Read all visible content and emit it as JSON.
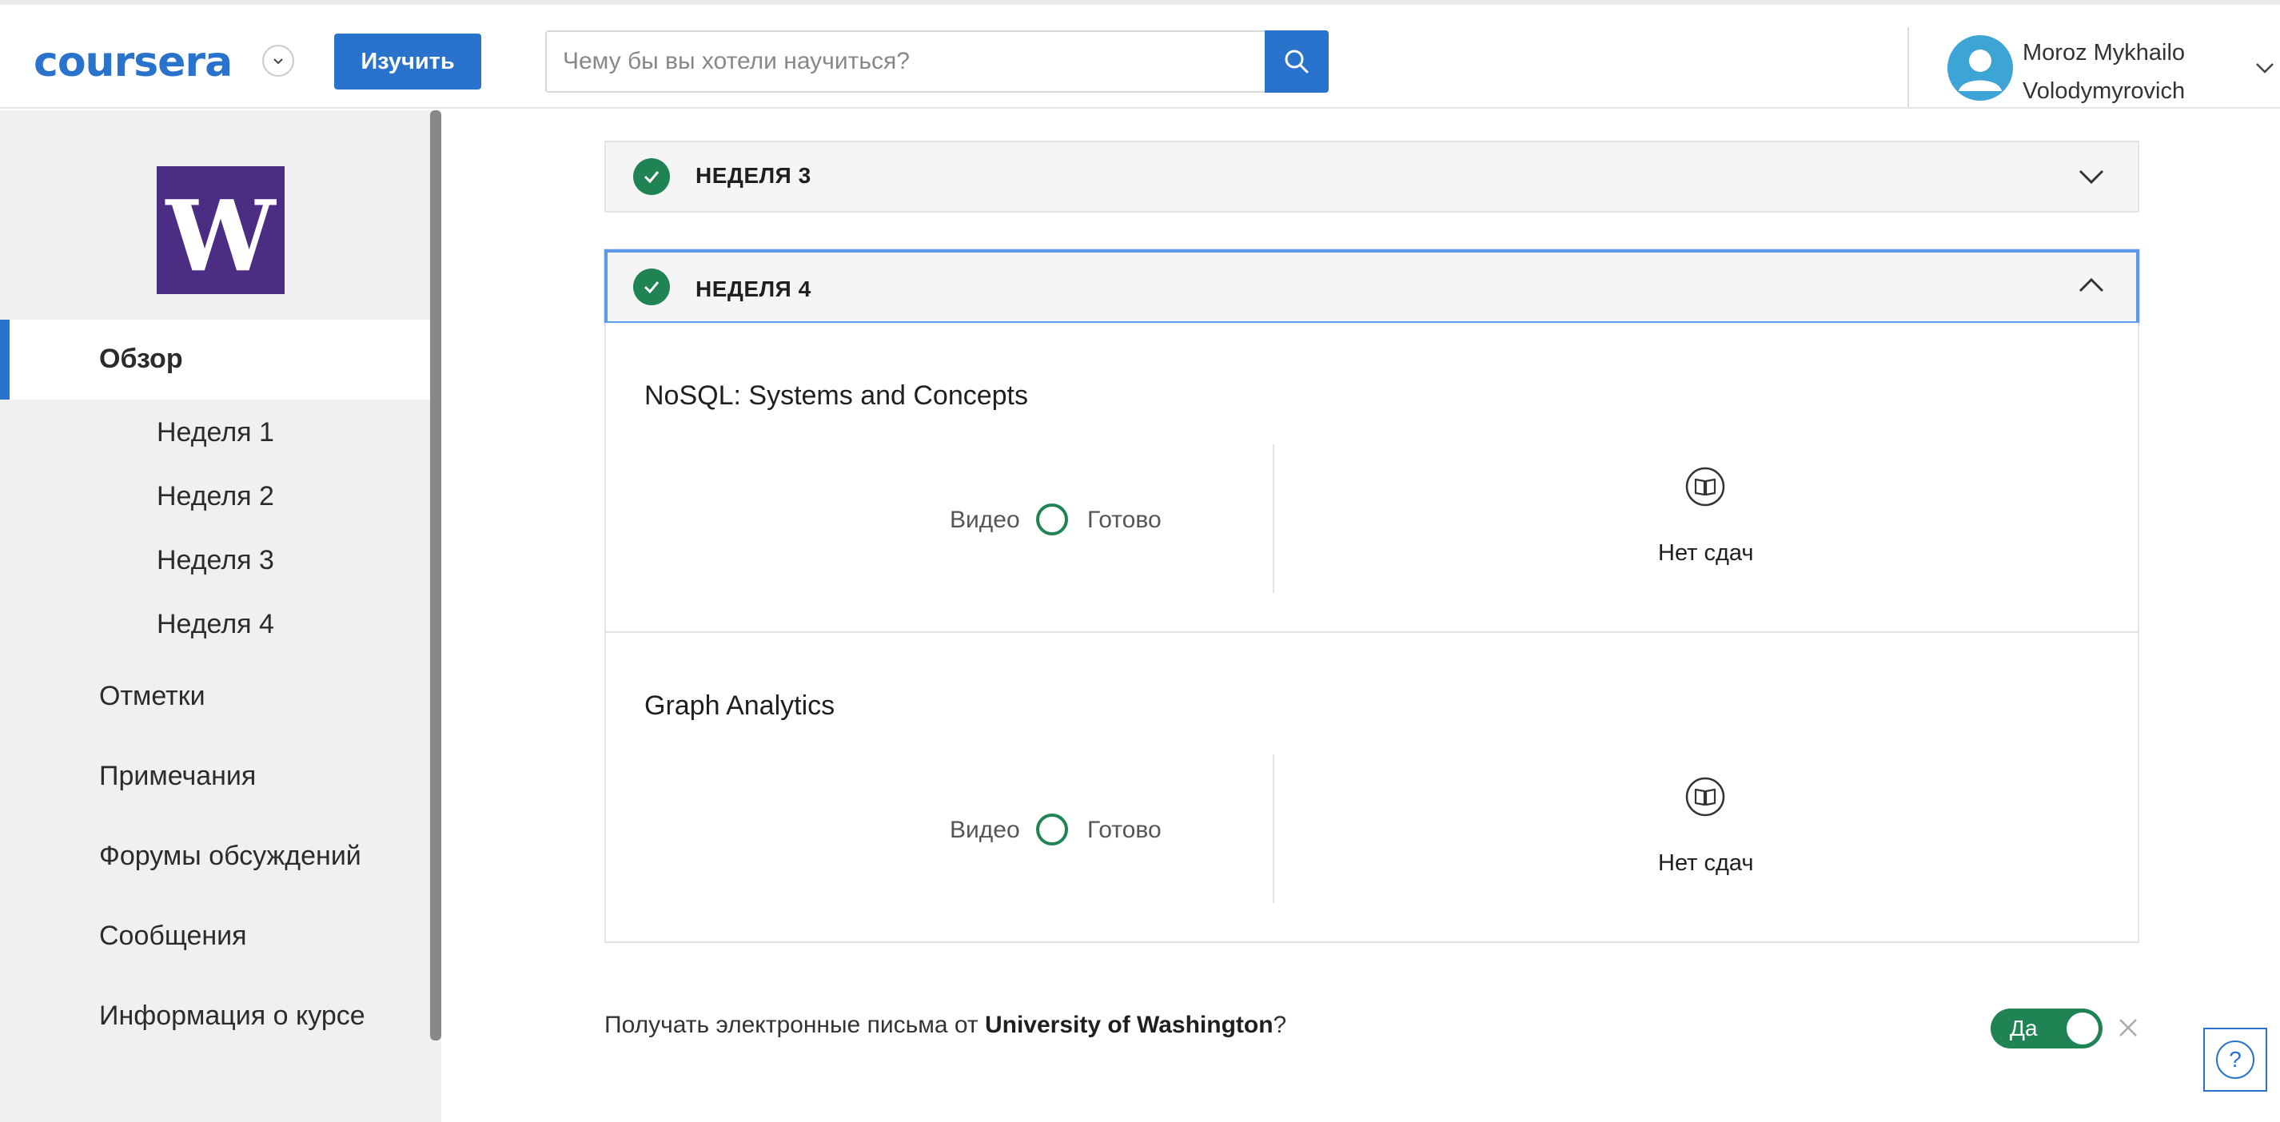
{
  "header": {
    "logo_text": "coursera",
    "explore_label": "Изучить",
    "search_placeholder": "Чему бы вы хотели научиться?",
    "user_name_line1": "Moroz Mykhailo",
    "user_name_line2": "Volodymyrovich"
  },
  "sidebar": {
    "logo_letter": "W",
    "items": [
      {
        "label": "Обзор",
        "active": true
      },
      {
        "label": "Неделя 1"
      },
      {
        "label": "Неделя 2"
      },
      {
        "label": "Неделя 3"
      },
      {
        "label": "Неделя 4"
      },
      {
        "label": "Отметки"
      },
      {
        "label": "Примечания"
      },
      {
        "label": "Форумы обсуждений"
      },
      {
        "label": "Сообщения"
      },
      {
        "label": "Информация о курсе"
      }
    ]
  },
  "weeks": [
    {
      "title": "НЕДЕЛЯ 3",
      "completed": true,
      "expanded": false
    },
    {
      "title": "НЕДЕЛЯ 4",
      "completed": true,
      "expanded": true
    }
  ],
  "lessons": [
    {
      "title": "NoSQL: Systems and Concepts",
      "video_label": "Видео",
      "status_label": "Готово",
      "submissions_label": "Нет сдач"
    },
    {
      "title": "Graph Analytics",
      "video_label": "Видео",
      "status_label": "Готово",
      "submissions_label": "Нет сдач"
    }
  ],
  "email_prompt": {
    "prefix": "Получать электронные письма от ",
    "university": "University of Washington",
    "suffix": "?",
    "toggle_label": "Да"
  },
  "help_label": "?",
  "colors": {
    "brand": "#2a73cc",
    "success": "#1f8354",
    "uw_purple": "#4b2e83"
  }
}
